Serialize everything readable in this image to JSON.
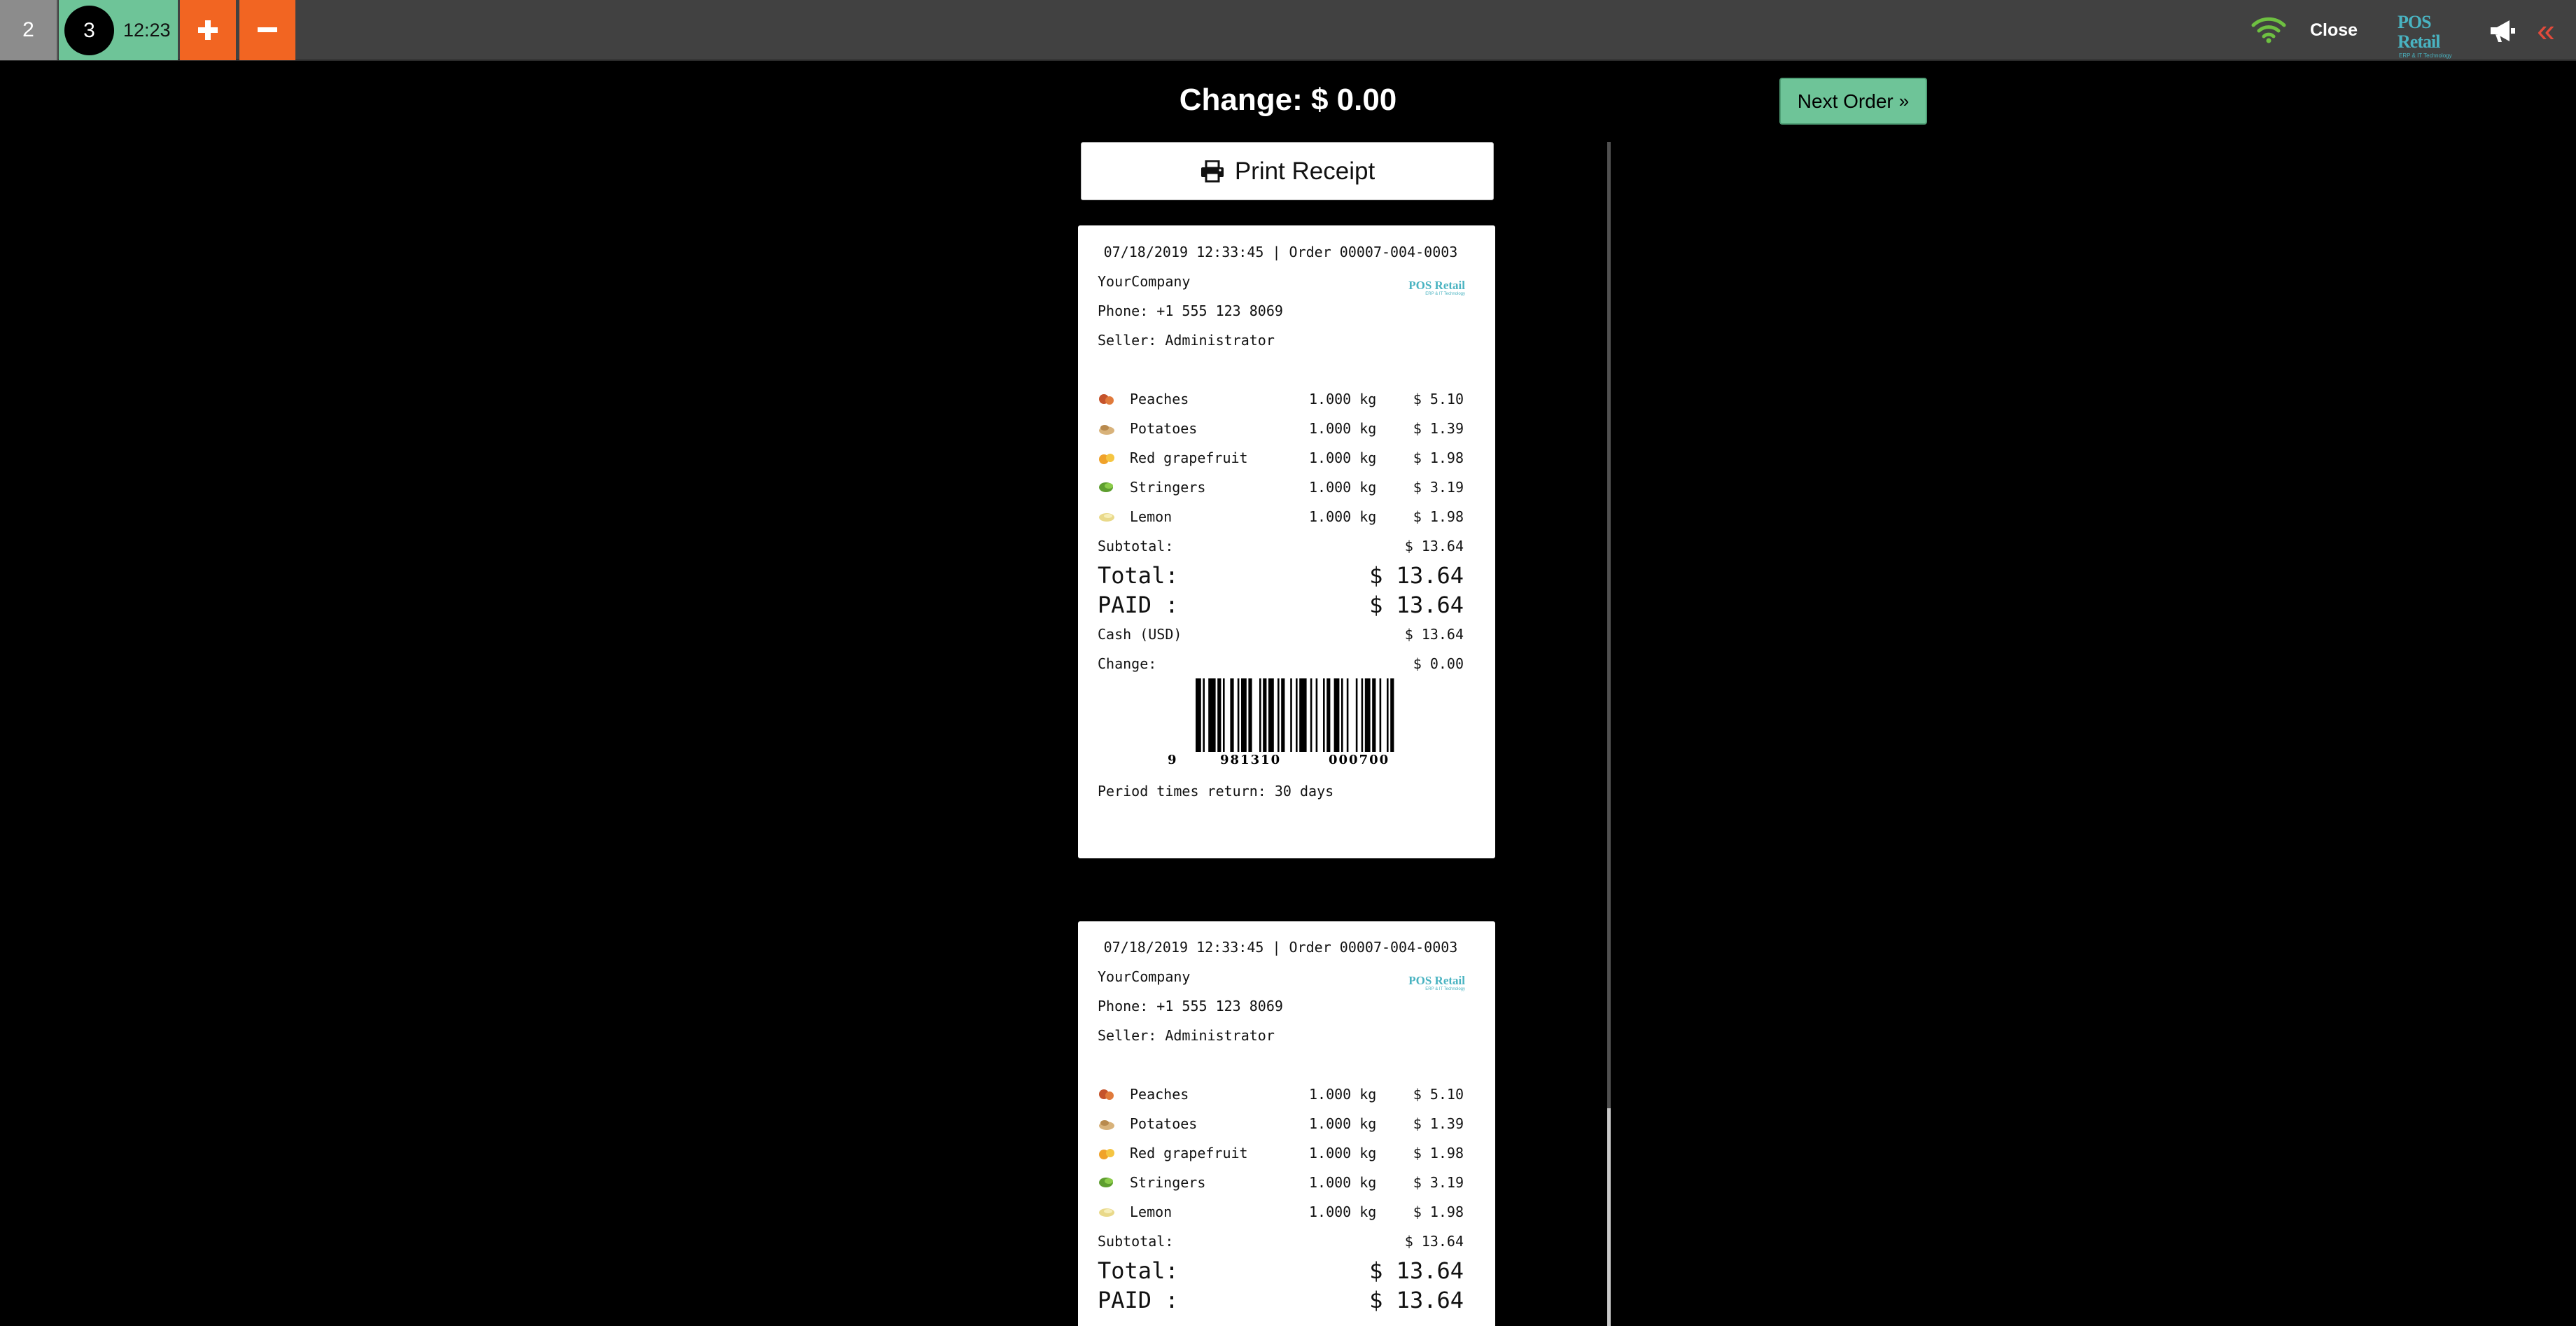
{
  "topbar": {
    "order_tab_number": "2",
    "active_order_number": "3",
    "active_order_time": "12:23",
    "close_label": "Close",
    "brand_name": "POS Retail",
    "brand_subtitle": "ERP & IT Technology",
    "colors": {
      "accent_green": "#6ec498",
      "accent_orange": "#f26522",
      "brand_teal": "#49b3c1",
      "collapse_red": "#e24a3b"
    },
    "icons": [
      "wifi-icon",
      "megaphone-icon",
      "double-chevron-left-icon",
      "plus-icon",
      "minus-icon"
    ]
  },
  "payment": {
    "change_title": "Change: $ 0.00",
    "next_order_label": "Next Order",
    "print_receipt_label": "Print Receipt"
  },
  "receipt": {
    "header": "07/18/2019 12:33:45 | Order 00007-004-0003",
    "company": "YourCompany",
    "phone": "Phone: +1 555 123 8069",
    "seller": "Seller: Administrator",
    "logo_name": "POS Retail",
    "logo_subtitle": "ERP & IT Technology",
    "lines": [
      {
        "icon": "peach-icon",
        "name": "Peaches",
        "qty": "1.000 kg",
        "price": "$ 5.10"
      },
      {
        "icon": "potato-icon",
        "name": "Potatoes",
        "qty": "1.000 kg",
        "price": "$ 1.39"
      },
      {
        "icon": "grapefruit-icon",
        "name": "Red grapefruit",
        "qty": "1.000 kg",
        "price": "$ 1.98"
      },
      {
        "icon": "stringers-icon",
        "name": "Stringers",
        "qty": "1.000 kg",
        "price": "$ 3.19"
      },
      {
        "icon": "lemon-icon",
        "name": "Lemon",
        "qty": "1.000 kg",
        "price": "$ 1.98"
      }
    ],
    "subtotal_label": "Subtotal:",
    "subtotal_value": "$ 13.64",
    "total_label": "Total:",
    "total_value": "$ 13.64",
    "paid_label": "PAID :",
    "paid_value": "$ 13.64",
    "cash_label": "Cash (USD)",
    "cash_value": "$ 13.64",
    "change_label": "Change:",
    "change_value": "$ 0.00",
    "barcode_digits": [
      "9",
      "981310",
      "000700"
    ],
    "return_policy": "Period times return: 30 days"
  }
}
